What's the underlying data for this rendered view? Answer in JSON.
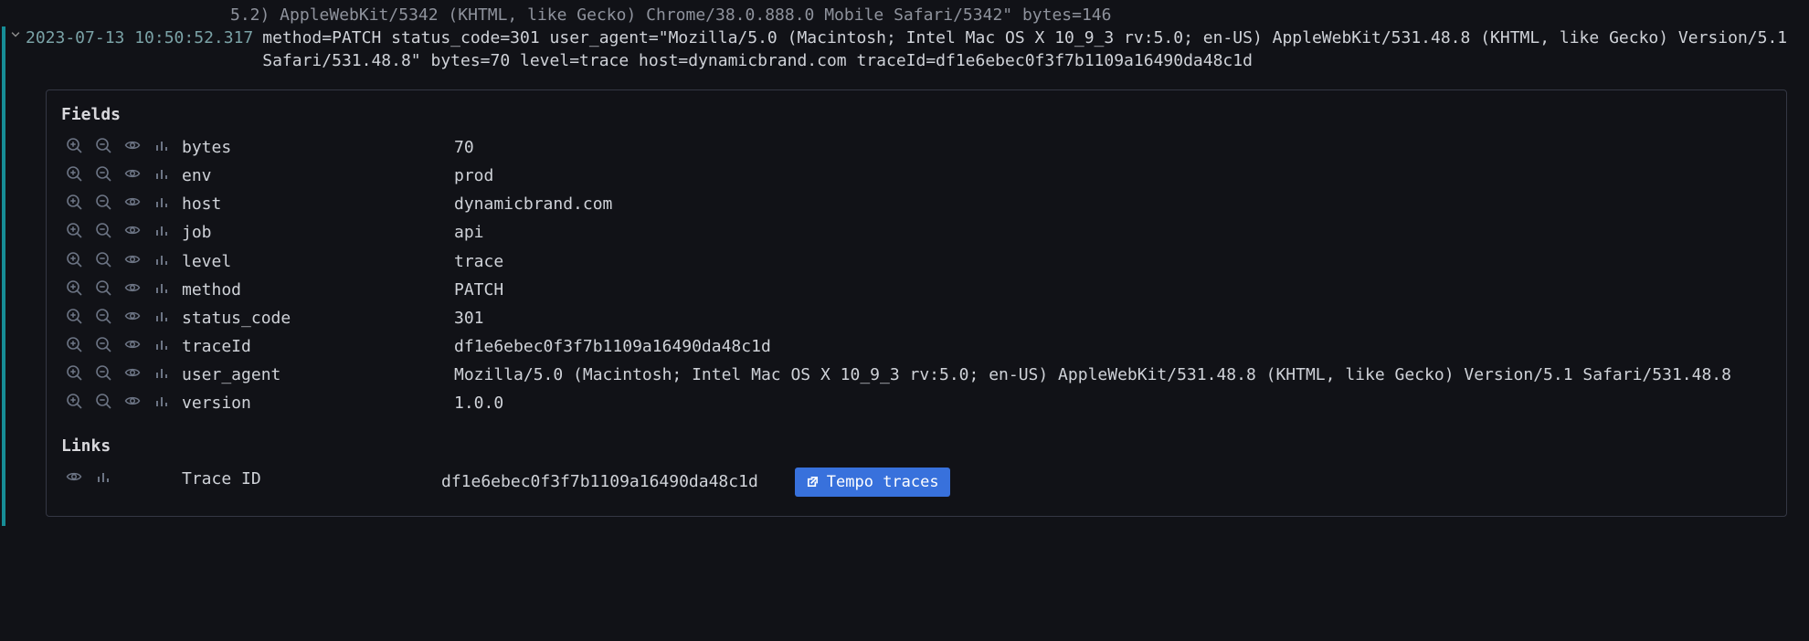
{
  "prev_log_tail": "5.2) AppleWebKit/5342 (KHTML, like Gecko) Chrome/38.0.888.0 Mobile Safari/5342\" bytes=146",
  "log": {
    "timestamp": "2023-07-13 10:50:52.317",
    "message": "method=PATCH status_code=301 user_agent=\"Mozilla/5.0 (Macintosh; Intel Mac OS X 10_9_3 rv:5.0; en-US) AppleWebKit/531.48.8 (KHTML, like Gecko) Version/5.1 Safari/531.48.8\" bytes=70 level=trace host=dynamicbrand.com traceId=df1e6ebec0f3f7b1109a16490da48c1d"
  },
  "fields_label": "Fields",
  "fields": [
    {
      "key": "bytes",
      "value": "70"
    },
    {
      "key": "env",
      "value": "prod"
    },
    {
      "key": "host",
      "value": "dynamicbrand.com"
    },
    {
      "key": "job",
      "value": "api"
    },
    {
      "key": "level",
      "value": "trace"
    },
    {
      "key": "method",
      "value": "PATCH"
    },
    {
      "key": "status_code",
      "value": "301"
    },
    {
      "key": "traceId",
      "value": "df1e6ebec0f3f7b1109a16490da48c1d"
    },
    {
      "key": "user_agent",
      "value": "Mozilla/5.0 (Macintosh; Intel Mac OS X 10_9_3 rv:5.0; en-US) AppleWebKit/531.48.8 (KHTML, like Gecko) Version/5.1 Safari/531.48.8"
    },
    {
      "key": "version",
      "value": "1.0.0"
    }
  ],
  "links_label": "Links",
  "link": {
    "key": "Trace ID",
    "value": "df1e6ebec0f3f7b1109a16490da48c1d",
    "button": "Tempo traces"
  }
}
